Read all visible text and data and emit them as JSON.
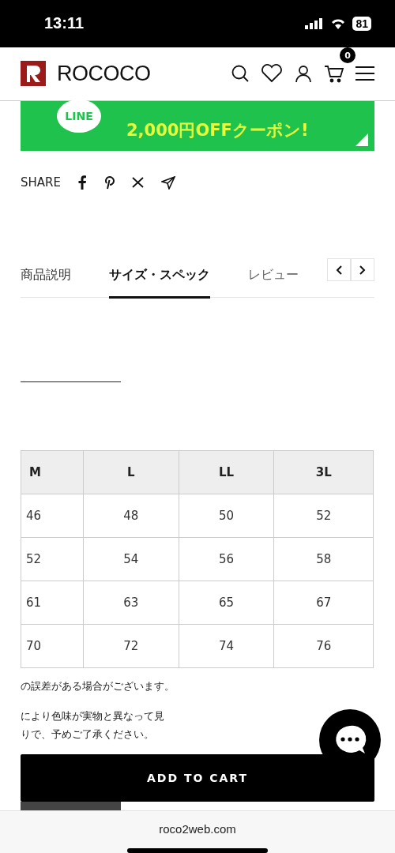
{
  "status_bar": {
    "time": "13:11",
    "battery": "81"
  },
  "header": {
    "brand": "ROCOCO",
    "cart_count": "0"
  },
  "banner": {
    "badge": "LINE",
    "headline": "2,000円OFFクーポン!"
  },
  "share": {
    "label": "SHARE"
  },
  "tabs": [
    {
      "label": "商品説明",
      "selected": false
    },
    {
      "label": "サイズ・スペック",
      "selected": true
    },
    {
      "label": "レビュー",
      "selected": false
    }
  ],
  "size_table": {
    "columns": [
      "M",
      "L",
      "LL",
      "3L"
    ],
    "rows": [
      [
        "46",
        "48",
        "50",
        "52"
      ],
      [
        "52",
        "54",
        "56",
        "58"
      ],
      [
        "61",
        "63",
        "65",
        "67"
      ],
      [
        "70",
        "72",
        "74",
        "76"
      ]
    ]
  },
  "notes": [
    "の誤差がある場合がございます。",
    "により色味が実物と異なって見",
    "りで、予めご了承ください。"
  ],
  "add_to_cart": "ADD TO CART",
  "browser": {
    "url": "roco2web.com"
  }
}
